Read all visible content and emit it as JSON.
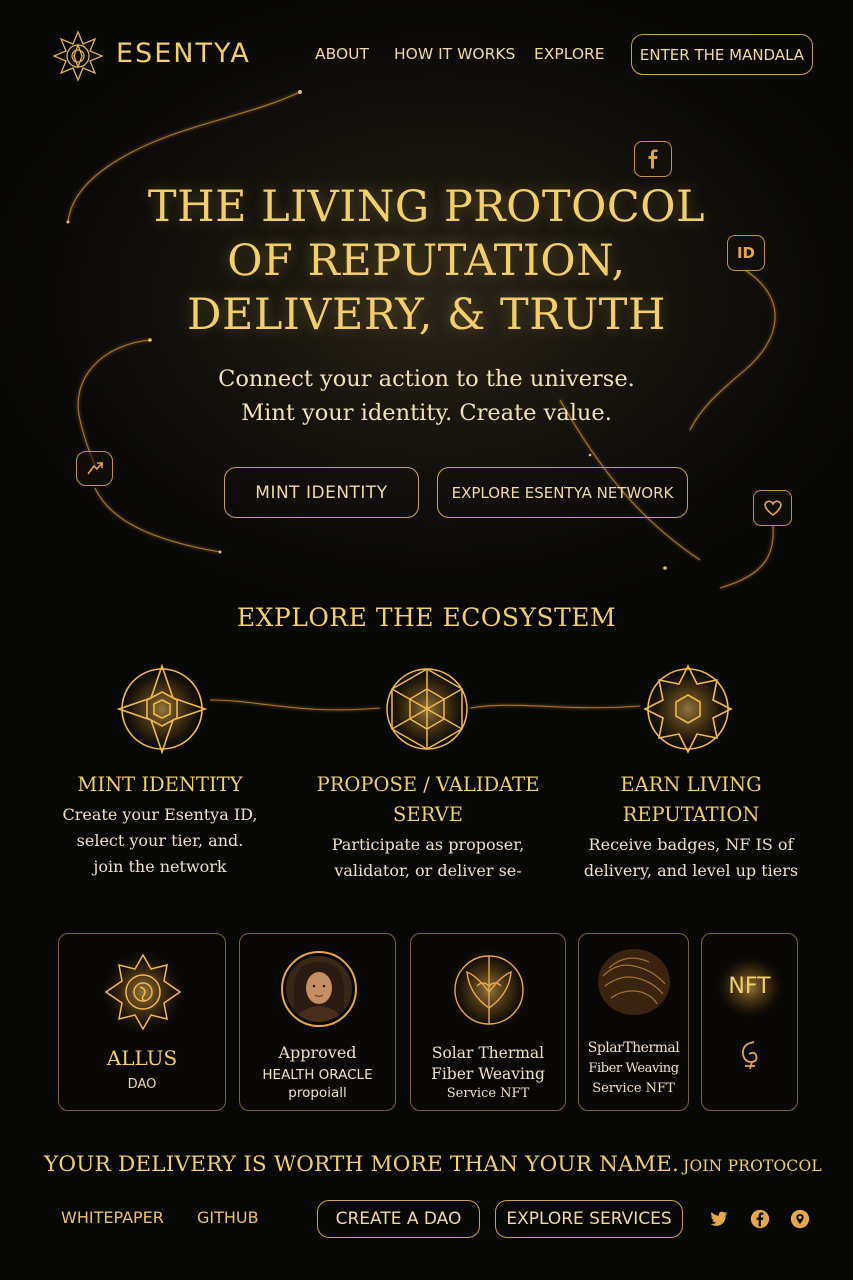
{
  "header": {
    "brand": "ESENTYA",
    "nav": [
      "ABOUT",
      "HOW IT WORKS",
      "EXPLORE"
    ],
    "cta": "ENTER THE MANDALA"
  },
  "hero": {
    "title_lines": [
      "THE LIVING PROTOCOL",
      "OF REPUTATION,",
      "DELIVERY, & TRUTH"
    ],
    "subtitle_lines": [
      "Connect your action to the universe.",
      "Mint your identity. Create value."
    ],
    "primary_button": "MINT IDENTITY",
    "secondary_button": "EXPLORE ESENTYA NETWORK",
    "floating_icons": [
      "facebook-icon",
      "id-icon",
      "share-icon",
      "heart-icon"
    ],
    "id_badge": "ID"
  },
  "ecosystem": {
    "title": "EXPLORE THE ECOSYSTEM",
    "columns": [
      {
        "title_lines": [
          "MINT IDENTITY"
        ],
        "desc_lines": [
          "Create your Esentya ID,",
          "select your tier, and.",
          "join the network"
        ]
      },
      {
        "title_lines": [
          "PROPOSE / VALIDATE",
          "SERVE"
        ],
        "desc_lines": [
          "Participate as proposer,",
          "validator, or deliver se-"
        ]
      },
      {
        "title_lines": [
          "EARN LIVING",
          "REPUTATION"
        ],
        "desc_lines": [
          "Receive badges, NF IS of",
          "delivery, and level up tiers"
        ]
      }
    ]
  },
  "cards": [
    {
      "title": "ALLUS",
      "sub": "DAO"
    },
    {
      "title": "Approved",
      "sub": "HEALTH ORACLE",
      "sub2": "propoiall"
    },
    {
      "title": "Solar Thermal",
      "sub": "Fiber Weaving",
      "sub2": "Service NFT"
    },
    {
      "title": "SplarThermal",
      "sub": "Fiber Weaving",
      "sub2": "Service NFT"
    },
    {
      "title": "NFT"
    }
  ],
  "footer": {
    "tagline": "YOUR DELIVERY IS WORTH MORE THAN YOUR NAME.",
    "join": "JOIN PROTOCOL",
    "links": [
      "WHITEPAPER",
      "GITHUB"
    ],
    "buttons": [
      "CREATE A DAO",
      "EXPLORE SERVICES"
    ],
    "social": [
      "twitter-icon",
      "facebook-icon",
      "telegram-icon"
    ]
  },
  "colors": {
    "background": "#0b0a08",
    "gold": "#f2cf6b",
    "accent": "#e3a64a",
    "border": "#c9a24e"
  }
}
